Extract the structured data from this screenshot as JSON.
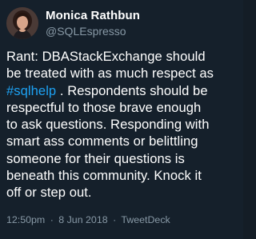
{
  "author": {
    "name": "Monica Rathbun",
    "handle": "@SQLEspresso"
  },
  "tweet": {
    "lines": [
      [
        "Rant: DBAStackExchange should"
      ],
      [
        "be treated with as much respect as"
      ],
      [
        "#sqlhelp",
        " . Respondents should be"
      ],
      [
        "respectful to those brave enough"
      ],
      [
        "to ask questions. Responding with"
      ],
      [
        "smart ass comments or belittling"
      ],
      [
        "someone for their questions is"
      ],
      [
        "beneath this community.  Knock it"
      ],
      [
        "off or step out."
      ]
    ]
  },
  "meta": {
    "time": "12:50pm",
    "separator": "·",
    "date": "8 Jun 2018",
    "source": "TweetDeck"
  },
  "colors": {
    "background": "#15202b",
    "text": "#ffffff",
    "secondary": "#8899a6",
    "hashtag": "#1da1f2"
  }
}
